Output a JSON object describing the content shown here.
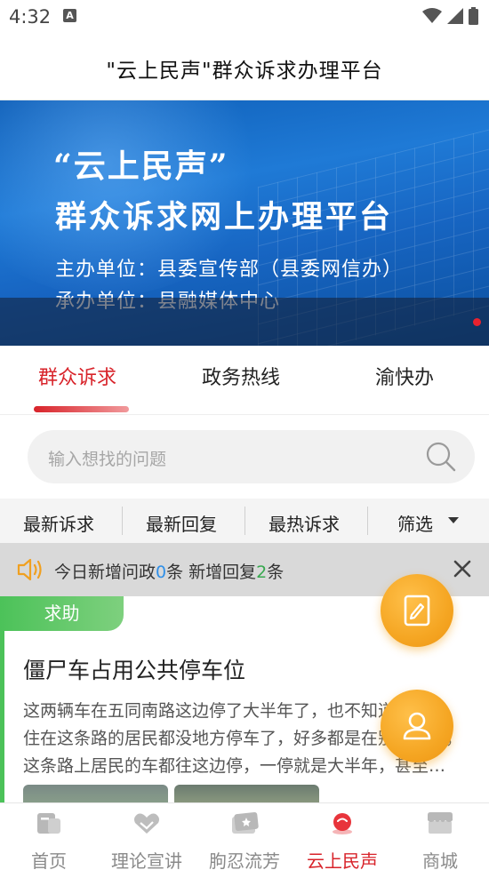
{
  "status_bar": {
    "time": "4:32",
    "notification_glyph": "A"
  },
  "header": {
    "title": "\"云上民声\"群众诉求办理平台"
  },
  "banner": {
    "quote_title": "“云上民声”",
    "heading": "群众诉求网上办理平台",
    "line1": "主办单位：县委宣传部（县委网信办）",
    "line2": "承办单位：县融媒体中心",
    "indicator_color": "#e8222f"
  },
  "tabs": [
    {
      "label": "群众诉求",
      "active": true
    },
    {
      "label": "政务热线",
      "active": false
    },
    {
      "label": "渝快办",
      "active": false
    }
  ],
  "search": {
    "placeholder": "输入想找的问题"
  },
  "sort_bar": {
    "items": [
      "最新诉求",
      "最新回复",
      "最热诉求",
      "筛选"
    ]
  },
  "notice": {
    "prefix": "今日新增问政",
    "new_count": "0",
    "middle": "条 新增回复",
    "reply_count": "2",
    "suffix": "条"
  },
  "list": [
    {
      "badge": "求助",
      "title": "僵尸车占用公共停车位",
      "excerpt": "这两辆车在五同南路这边停了大半年了，也不知道是谁的，住在这条路的居民都没地方停车了，好多都是在别的地方，这条路上居民的车都往这边停，一停就是大半年，甚至…"
    }
  ],
  "bottom_nav": [
    {
      "label": "首页",
      "icon": "home-icon",
      "active": false
    },
    {
      "label": "理论宣讲",
      "icon": "handshake-icon",
      "active": false
    },
    {
      "label": "朐忍流芳",
      "icon": "ticket-icon",
      "active": false
    },
    {
      "label": "云上民声",
      "icon": "voice-icon",
      "active": true
    },
    {
      "label": "商城",
      "icon": "store-icon",
      "active": false
    }
  ],
  "colors": {
    "accent_red": "#d8232a",
    "badge_green": "#4cc259",
    "fab_orange": "#f5a623",
    "count_blue": "#2f8fe8",
    "count_green": "#37a84e"
  }
}
